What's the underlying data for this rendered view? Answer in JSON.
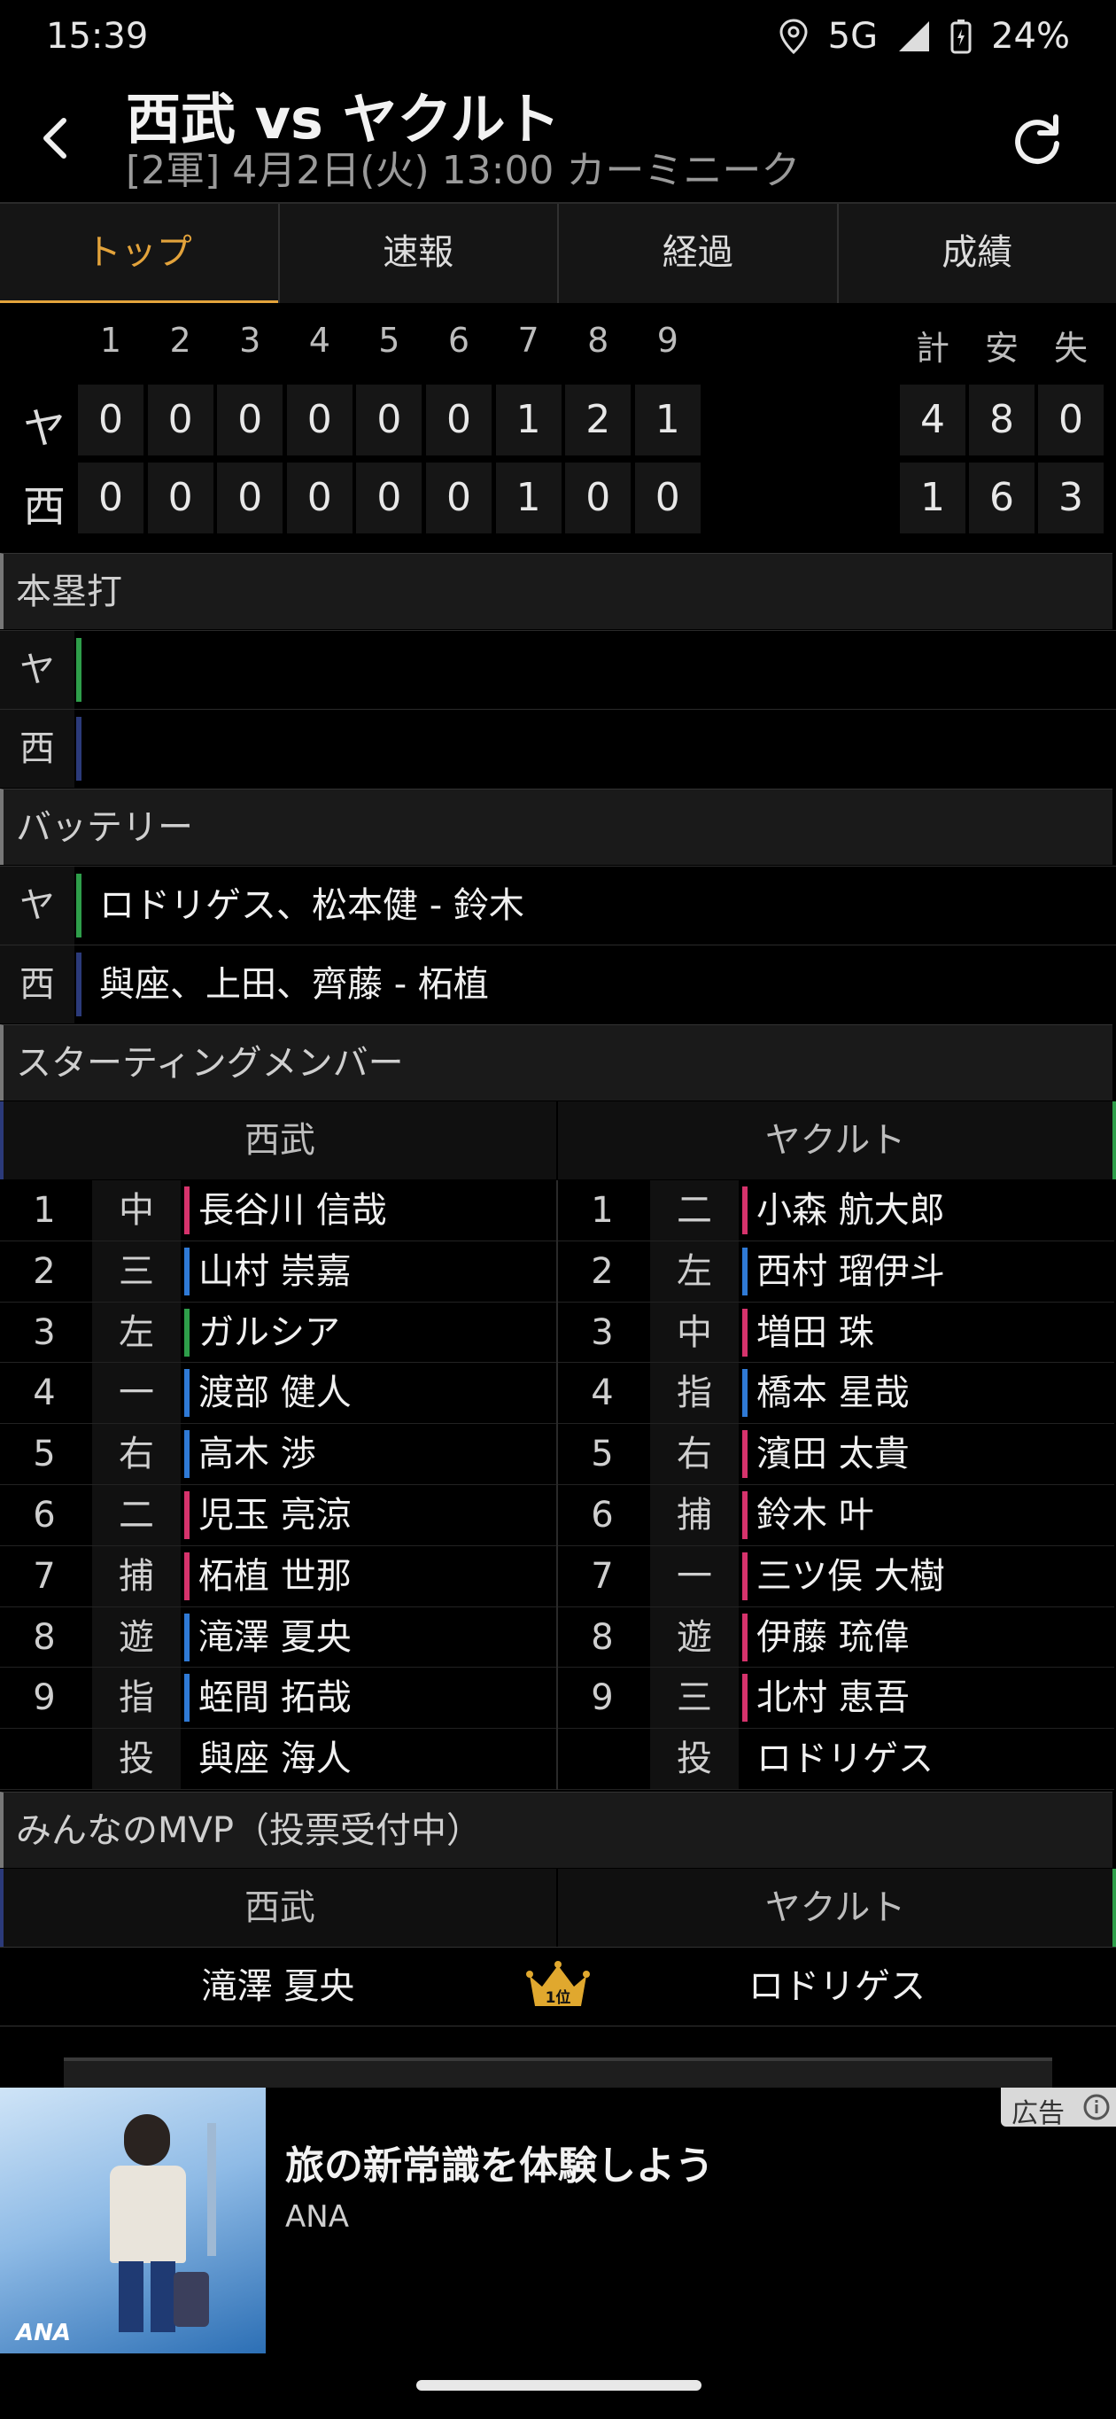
{
  "status": {
    "time": "15:39",
    "network": "5G",
    "battery": "24%"
  },
  "header": {
    "title": "西武 vs ヤクルト",
    "subtitle": "[2軍] 4月2日(火) 13:00 カーミニーク"
  },
  "tabs": [
    "トップ",
    "速報",
    "経過",
    "成績"
  ],
  "score": {
    "innings": [
      "1",
      "2",
      "3",
      "4",
      "5",
      "6",
      "7",
      "8",
      "9"
    ],
    "totals_headers": [
      "計",
      "安",
      "失"
    ],
    "teams": [
      {
        "label": "ヤ",
        "runs": [
          "0",
          "0",
          "0",
          "0",
          "0",
          "0",
          "1",
          "2",
          "1"
        ],
        "totals": [
          "4",
          "8",
          "0"
        ]
      },
      {
        "label": "西",
        "runs": [
          "0",
          "0",
          "0",
          "0",
          "0",
          "0",
          "1",
          "0",
          "0"
        ],
        "totals": [
          "1",
          "6",
          "3"
        ]
      }
    ]
  },
  "homeruns": {
    "title": "本塁打",
    "rows": [
      {
        "label": "ヤ",
        "value": ""
      },
      {
        "label": "西",
        "value": ""
      }
    ]
  },
  "battery": {
    "title": "バッテリー",
    "rows": [
      {
        "label": "ヤ",
        "value": "ロドリゲス、松本健 - 鈴木"
      },
      {
        "label": "西",
        "value": "與座、上田、齊藤 - 柘植"
      }
    ]
  },
  "lineup": {
    "title": "スターティングメンバー",
    "home_name": "西武",
    "away_name": "ヤクルト",
    "home": [
      {
        "num": "1",
        "pos": "中",
        "name": "長谷川 信哉"
      },
      {
        "num": "2",
        "pos": "三",
        "name": "山村 崇嘉"
      },
      {
        "num": "3",
        "pos": "左",
        "name": "ガルシア"
      },
      {
        "num": "4",
        "pos": "一",
        "name": "渡部 健人"
      },
      {
        "num": "5",
        "pos": "右",
        "name": "高木 渉"
      },
      {
        "num": "6",
        "pos": "二",
        "name": "児玉 亮涼"
      },
      {
        "num": "7",
        "pos": "捕",
        "name": "柘植 世那"
      },
      {
        "num": "8",
        "pos": "遊",
        "name": "滝澤 夏央"
      },
      {
        "num": "9",
        "pos": "指",
        "name": "蛭間 拓哉"
      },
      {
        "num": "",
        "pos": "投",
        "name": "與座 海人"
      }
    ],
    "away": [
      {
        "num": "1",
        "pos": "二",
        "name": "小森 航大郎"
      },
      {
        "num": "2",
        "pos": "左",
        "name": "西村 瑠伊斗"
      },
      {
        "num": "3",
        "pos": "中",
        "name": "増田 珠"
      },
      {
        "num": "4",
        "pos": "指",
        "name": "橋本 星哉"
      },
      {
        "num": "5",
        "pos": "右",
        "name": "濱田 太貴"
      },
      {
        "num": "6",
        "pos": "捕",
        "name": "鈴木 叶"
      },
      {
        "num": "7",
        "pos": "一",
        "name": "三ツ俣 大樹"
      },
      {
        "num": "8",
        "pos": "遊",
        "name": "伊藤 琉偉"
      },
      {
        "num": "9",
        "pos": "三",
        "name": "北村 恵吾"
      },
      {
        "num": "",
        "pos": "投",
        "name": "ロドリゲス"
      }
    ]
  },
  "mvp": {
    "title": "みんなのMVP（投票受付中）",
    "home_name": "西武",
    "away_name": "ヤクルト",
    "home_mvp": "滝澤 夏央",
    "away_mvp": "ロドリゲス",
    "rank_label": "1位"
  },
  "ad": {
    "badge": "広告",
    "headline": "旅の新常識を体験しよう",
    "advertiser": "ANA",
    "logo": "ANA"
  }
}
